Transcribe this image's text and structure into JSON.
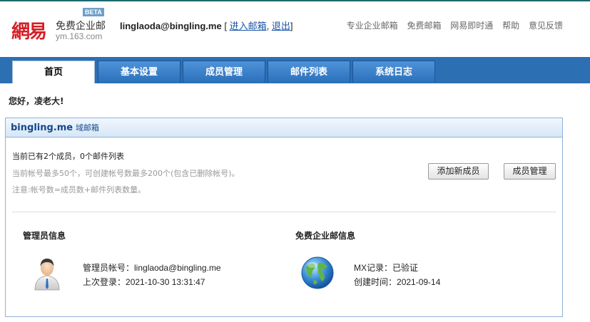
{
  "logo": {
    "mark": "網易",
    "title": "免费企业邮",
    "beta": "BETA",
    "url": "ym.163.com"
  },
  "account": {
    "email": "linglaoda@bingling.me",
    "open_bracket": "[",
    "enter_mail": "进入邮箱",
    "sep": ",",
    "logout": "退出",
    "close_bracket": "]"
  },
  "topnav": [
    "专业企业邮箱",
    "免费邮箱",
    "网易即时通",
    "帮助",
    "意见反馈"
  ],
  "tabs": [
    "首页",
    "基本设置",
    "成员管理",
    "邮件列表",
    "系统日志"
  ],
  "greeting": "您好，凌老大!",
  "panel": {
    "domain": "bingling.me",
    "domain_type": "域邮箱",
    "line1": "当前已有2个成员，0个邮件列表",
    "line2": "当前帐号最多50个，可创建帐号数最多200个(包含已删除帐号)。",
    "line3": "注意:帐号数=成员数+邮件列表数量。",
    "add_member": "添加新成员",
    "manage_members": "成员管理"
  },
  "admin": {
    "title": "管理员信息",
    "account_label": "管理员帐号：",
    "account_value": "linglaoda@bingling.me",
    "last_login_label": "上次登录：",
    "last_login_value": "2021-10-30 13:31:47"
  },
  "free": {
    "title": "免费企业邮信息",
    "mx_label": "MX记录：",
    "mx_value": "已验证",
    "created_label": "创建时间：",
    "created_value": "2021-09-14"
  },
  "colors": {
    "nav": "#2d6fb3",
    "logo_red": "#d41f26",
    "link": "#1a55a8",
    "panel_border": "#8fb2d6"
  }
}
